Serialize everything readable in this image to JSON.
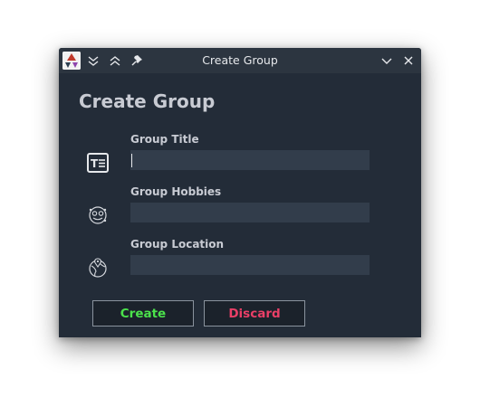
{
  "window": {
    "title": "Create Group"
  },
  "titlebar": {
    "app_icon": "app-icon",
    "left_buttons": [
      "keep-below-icon",
      "keep-above-icon",
      "pin-icon"
    ],
    "right_buttons": [
      "minimize-icon",
      "close-icon"
    ]
  },
  "form": {
    "heading": "Create Group",
    "fields": [
      {
        "label": "Group Title",
        "value": "",
        "icon": "text-field-icon"
      },
      {
        "label": "Group Hobbies",
        "value": "",
        "icon": "hobbies-icon"
      },
      {
        "label": "Group Location",
        "value": "",
        "icon": "location-icon"
      }
    ]
  },
  "buttons": {
    "create_label": "Create",
    "discard_label": "Discard"
  },
  "colors": {
    "window_bg": "#232c38",
    "titlebar_bg": "#2c3540",
    "input_bg": "#323d4b",
    "create_text": "#4be14b",
    "discard_text": "#ea3f67",
    "label_text": "#c8cbd3"
  }
}
